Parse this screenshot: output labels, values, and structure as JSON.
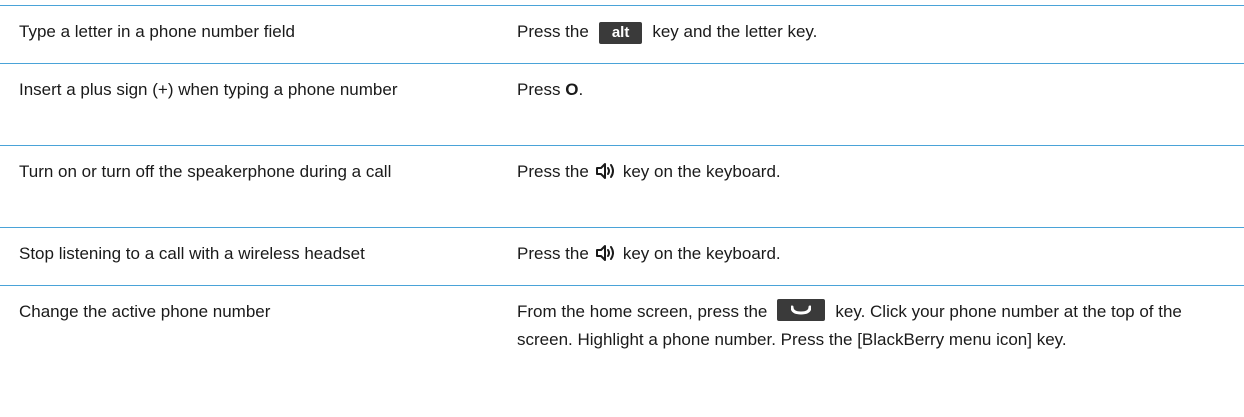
{
  "rows": [
    {
      "action": "Type a letter in a phone number field",
      "how_prefix": "Press the",
      "how_key": "alt",
      "how_suffix": "key and the letter key."
    },
    {
      "action": "Insert a plus sign (+) when typing a phone number",
      "how_prefix": "Press",
      "how_key": "O",
      "how_suffix": "."
    },
    {
      "action": "Turn on or turn off the speakerphone during a call",
      "how_prefix": "Press the",
      "how_icon": "speakerphone-icon",
      "how_suffix": "key on the keyboard."
    },
    {
      "action": "Stop listening to a call with a wireless headset",
      "how_prefix": "Press the",
      "how_icon": "speakerphone-icon",
      "how_suffix": "key on the keyboard."
    },
    {
      "action": "Change the active phone number",
      "how_prefix": "From the home screen, press the",
      "how_icon": "send-key-icon",
      "how_suffix": "key. Click your phone number at the top of the screen. Highlight a phone number. Press the [BlackBerry menu icon] key."
    }
  ],
  "colors": {
    "rule": "#4aa3d8",
    "key_bg": "#3a3a3a",
    "text": "#1a1a1a"
  }
}
